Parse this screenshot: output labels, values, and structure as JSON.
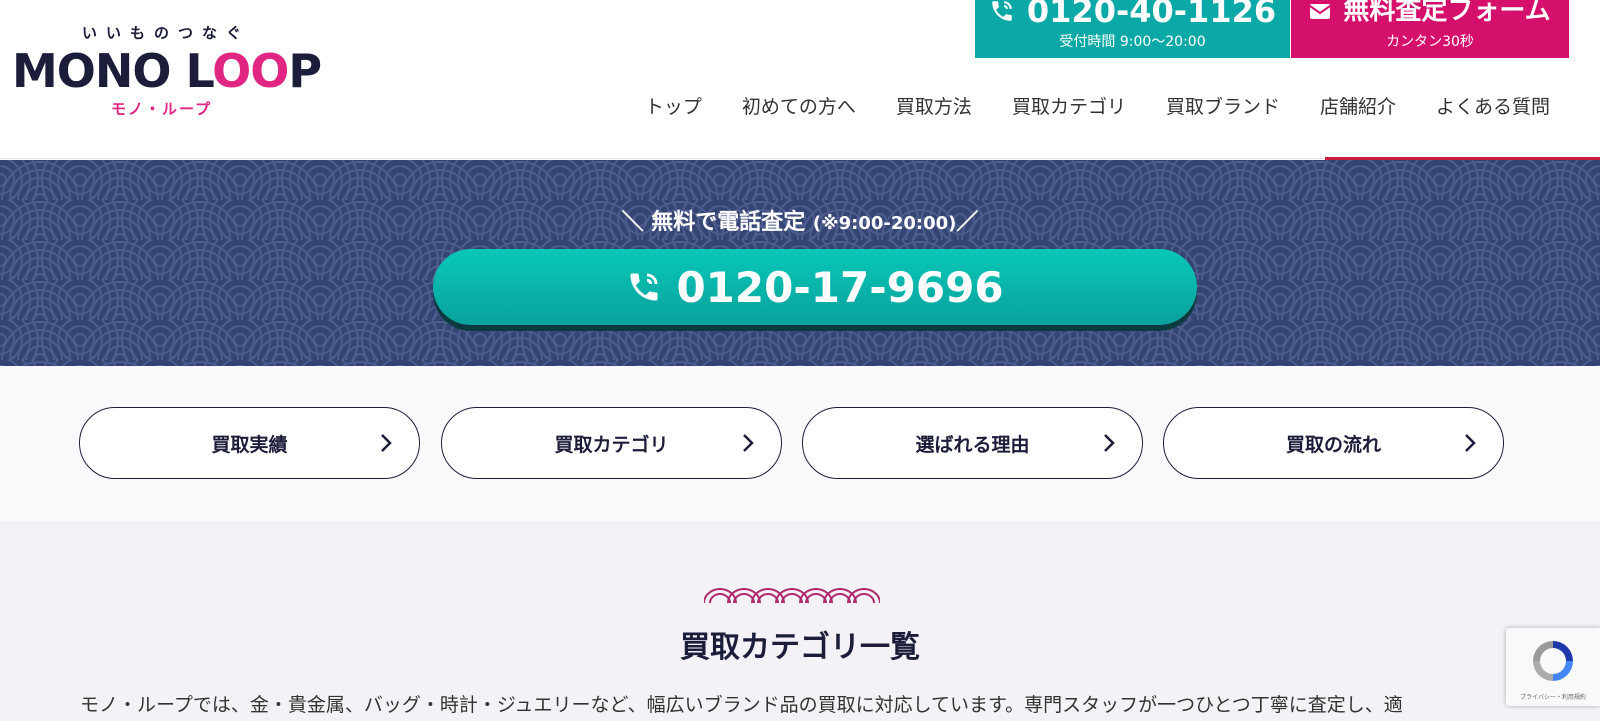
{
  "header": {
    "logo": {
      "tagline": "いいものつなぐ",
      "name_part1": "MONO L",
      "name_loop": "OO",
      "name_part2": "P",
      "subtitle": "モノ・ループ"
    },
    "phone_cta": {
      "number": "0120-40-1126",
      "hours": "受付時間 9:00〜20:00",
      "icon": "phone-icon"
    },
    "form_cta": {
      "label": "無料査定フォーム",
      "sub": "カンタン30秒",
      "icon": "mail-icon"
    },
    "nav": [
      "トップ",
      "初めての方へ",
      "買取方法",
      "買取カテゴリ",
      "買取ブランド",
      "店舗紹介",
      "よくある質問"
    ]
  },
  "banner": {
    "lead_main": "＼ 無料で電話査定",
    "lead_small": "(※9:00-20:00)",
    "lead_end": "／",
    "phone": "0120-17-9696",
    "icon": "phone-icon"
  },
  "quick_nav": [
    "買取実績",
    "買取カテゴリ",
    "選ばれる理由",
    "買取の流れ"
  ],
  "section": {
    "title": "買取カテゴリ一覧",
    "description": "モノ・ループでは、金・貴金属、バッグ・時計・ジュエリーなど、幅広いブランド品の買取に対応しています。専門スタッフが一つひとつ丁寧に査定し、適"
  },
  "recaptcha": {
    "text": "プライバシー・利用規約"
  },
  "colors": {
    "navy": "#1c1d3a",
    "pink": "#e02582",
    "teal": "#0aa8a6",
    "magenta": "#d4106c",
    "banner_bg": "#354573"
  }
}
